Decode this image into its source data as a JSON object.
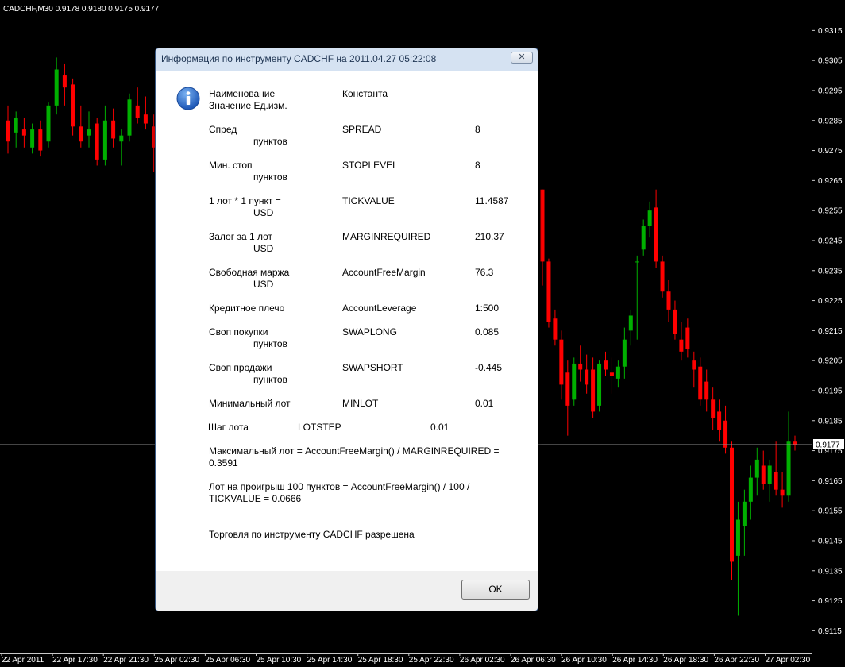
{
  "chart_data": {
    "type": "candlestick",
    "title": "CADCHF,M30  0.9178 0.9180 0.9175 0.9177",
    "symbol": "CADCHF",
    "timeframe": "M30",
    "quote": {
      "open": 0.9178,
      "high": 0.918,
      "low": 0.9175,
      "close": 0.9177
    },
    "current_price_label": "0.9177",
    "current_price": 0.9177,
    "ylim": [
      0.911,
      0.9322
    ],
    "y_ticks": [
      "0.9315",
      "0.9305",
      "0.9295",
      "0.9285",
      "0.9275",
      "0.9265",
      "0.9255",
      "0.9245",
      "0.9235",
      "0.9225",
      "0.9215",
      "0.9205",
      "0.9195",
      "0.9185",
      "0.9175",
      "0.9165",
      "0.9155",
      "0.9145",
      "0.9135",
      "0.9125",
      "0.9115"
    ],
    "x_ticks": [
      "22 Apr 2011",
      "22 Apr 17:30",
      "22 Apr 21:30",
      "25 Apr 02:30",
      "25 Apr 06:30",
      "25 Apr 10:30",
      "25 Apr 14:30",
      "25 Apr 18:30",
      "25 Apr 22:30",
      "26 Apr 02:30",
      "26 Apr 06:30",
      "26 Apr 10:30",
      "26 Apr 14:30",
      "26 Apr 18:30",
      "26 Apr 22:30",
      "27 Apr 02:30"
    ],
    "bull_color": "#00b000",
    "bear_color": "#ff0000",
    "background": "#000000",
    "grid": false,
    "candles": [
      {
        "o": 0.9285,
        "h": 0.929,
        "l": 0.9274,
        "c": 0.9278
      },
      {
        "o": 0.9281,
        "h": 0.9288,
        "l": 0.9276,
        "c": 0.9286
      },
      {
        "o": 0.9282,
        "h": 0.9286,
        "l": 0.9276,
        "c": 0.928
      },
      {
        "o": 0.9276,
        "h": 0.9284,
        "l": 0.9274,
        "c": 0.9282
      },
      {
        "o": 0.9282,
        "h": 0.9285,
        "l": 0.9273,
        "c": 0.9275
      },
      {
        "o": 0.9278,
        "h": 0.9291,
        "l": 0.9276,
        "c": 0.929
      },
      {
        "o": 0.929,
        "h": 0.9306,
        "l": 0.9287,
        "c": 0.9302
      },
      {
        "o": 0.93,
        "h": 0.9304,
        "l": 0.929,
        "c": 0.9296
      },
      {
        "o": 0.9297,
        "h": 0.9299,
        "l": 0.928,
        "c": 0.9283
      },
      {
        "o": 0.9283,
        "h": 0.929,
        "l": 0.9276,
        "c": 0.9278
      },
      {
        "o": 0.928,
        "h": 0.9288,
        "l": 0.9276,
        "c": 0.9282
      },
      {
        "o": 0.9284,
        "h": 0.9286,
        "l": 0.927,
        "c": 0.9272
      },
      {
        "o": 0.9272,
        "h": 0.929,
        "l": 0.927,
        "c": 0.9285
      },
      {
        "o": 0.9285,
        "h": 0.9289,
        "l": 0.9276,
        "c": 0.9279
      },
      {
        "o": 0.9278,
        "h": 0.9282,
        "l": 0.927,
        "c": 0.928
      },
      {
        "o": 0.928,
        "h": 0.9294,
        "l": 0.9278,
        "c": 0.9292
      },
      {
        "o": 0.929,
        "h": 0.9296,
        "l": 0.9284,
        "c": 0.9286
      },
      {
        "o": 0.9287,
        "h": 0.9293,
        "l": 0.9282,
        "c": 0.9284
      },
      {
        "o": 0.9283,
        "h": 0.9287,
        "l": 0.9268,
        "c": 0.9276
      },
      {
        "o": 0.9276,
        "h": 0.9286,
        "l": 0.9268,
        "c": 0.9283
      },
      {
        "o": 0.9262,
        "h": 0.9262,
        "l": 0.923,
        "c": 0.9238
      },
      {
        "o": 0.9238,
        "h": 0.9239,
        "l": 0.9216,
        "c": 0.9218
      },
      {
        "o": 0.9219,
        "h": 0.9222,
        "l": 0.921,
        "c": 0.9212
      },
      {
        "o": 0.9212,
        "h": 0.9215,
        "l": 0.9192,
        "c": 0.9197
      },
      {
        "o": 0.9201,
        "h": 0.9205,
        "l": 0.918,
        "c": 0.919
      },
      {
        "o": 0.9192,
        "h": 0.9206,
        "l": 0.919,
        "c": 0.9204
      },
      {
        "o": 0.9204,
        "h": 0.921,
        "l": 0.9198,
        "c": 0.9202
      },
      {
        "o": 0.9202,
        "h": 0.9207,
        "l": 0.9194,
        "c": 0.9197
      },
      {
        "o": 0.9202,
        "h": 0.9206,
        "l": 0.9186,
        "c": 0.9188
      },
      {
        "o": 0.919,
        "h": 0.9205,
        "l": 0.9188,
        "c": 0.9204
      },
      {
        "o": 0.9205,
        "h": 0.9208,
        "l": 0.92,
        "c": 0.9202
      },
      {
        "o": 0.9201,
        "h": 0.9206,
        "l": 0.9194,
        "c": 0.92
      },
      {
        "o": 0.9199,
        "h": 0.9205,
        "l": 0.9196,
        "c": 0.9203
      },
      {
        "o": 0.9203,
        "h": 0.9216,
        "l": 0.9199,
        "c": 0.9212
      },
      {
        "o": 0.9215,
        "h": 0.9222,
        "l": 0.921,
        "c": 0.922
      },
      {
        "o": 0.9238,
        "h": 0.924,
        "l": 0.9212,
        "c": 0.9238
      },
      {
        "o": 0.9242,
        "h": 0.9252,
        "l": 0.924,
        "c": 0.925
      },
      {
        "o": 0.925,
        "h": 0.9258,
        "l": 0.9246,
        "c": 0.9255
      },
      {
        "o": 0.9256,
        "h": 0.9262,
        "l": 0.9236,
        "c": 0.9238
      },
      {
        "o": 0.9238,
        "h": 0.924,
        "l": 0.9226,
        "c": 0.9228
      },
      {
        "o": 0.9228,
        "h": 0.9232,
        "l": 0.9218,
        "c": 0.9222
      },
      {
        "o": 0.9222,
        "h": 0.9225,
        "l": 0.9212,
        "c": 0.9214
      },
      {
        "o": 0.9212,
        "h": 0.9218,
        "l": 0.9205,
        "c": 0.9208
      },
      {
        "o": 0.9216,
        "h": 0.9219,
        "l": 0.9206,
        "c": 0.9209
      },
      {
        "o": 0.9205,
        "h": 0.9208,
        "l": 0.9196,
        "c": 0.9202
      },
      {
        "o": 0.9203,
        "h": 0.9206,
        "l": 0.919,
        "c": 0.9192
      },
      {
        "o": 0.9198,
        "h": 0.9202,
        "l": 0.9188,
        "c": 0.9192
      },
      {
        "o": 0.9192,
        "h": 0.9196,
        "l": 0.9182,
        "c": 0.9186
      },
      {
        "o": 0.9188,
        "h": 0.9192,
        "l": 0.9178,
        "c": 0.9182
      },
      {
        "o": 0.9185,
        "h": 0.919,
        "l": 0.9174,
        "c": 0.9176
      },
      {
        "o": 0.9176,
        "h": 0.9178,
        "l": 0.9132,
        "c": 0.9138
      },
      {
        "o": 0.914,
        "h": 0.9158,
        "l": 0.912,
        "c": 0.9152
      },
      {
        "o": 0.915,
        "h": 0.9162,
        "l": 0.914,
        "c": 0.9158
      },
      {
        "o": 0.9158,
        "h": 0.917,
        "l": 0.9152,
        "c": 0.9166
      },
      {
        "o": 0.9166,
        "h": 0.9176,
        "l": 0.916,
        "c": 0.9172
      },
      {
        "o": 0.917,
        "h": 0.9175,
        "l": 0.9162,
        "c": 0.9164
      },
      {
        "o": 0.9164,
        "h": 0.9172,
        "l": 0.9158,
        "c": 0.917
      },
      {
        "o": 0.9168,
        "h": 0.9178,
        "l": 0.916,
        "c": 0.9162
      },
      {
        "o": 0.9162,
        "h": 0.9168,
        "l": 0.9156,
        "c": 0.916
      },
      {
        "o": 0.916,
        "h": 0.9188,
        "l": 0.9158,
        "c": 0.9178
      },
      {
        "o": 0.9178,
        "h": 0.918,
        "l": 0.9175,
        "c": 0.9177
      }
    ]
  },
  "dialog": {
    "title": "Информация по инструменту CADCHF на 2011.04.27 05:22:08",
    "close_label": "✕",
    "icon": "info-icon",
    "header": {
      "name_col": "Наименование",
      "value_units": "Значение Ед.изм.",
      "const_col": "Константа"
    },
    "rows": [
      {
        "name": "Спред",
        "unit": "пунктов",
        "const": "SPREAD",
        "value": "8"
      },
      {
        "name": "Мин. стоп",
        "unit": "пунктов",
        "const": "STOPLEVEL",
        "value": "8"
      },
      {
        "name": "1 лот * 1 пункт =",
        "unit": "USD",
        "const": "TICKVALUE",
        "value": "11.4587"
      },
      {
        "name": "Залог за 1 лот",
        "unit": "USD",
        "const": "MARGINREQUIRED",
        "value": "210.37"
      },
      {
        "name": "Свободная маржа",
        "unit": "USD",
        "const": "AccountFreeMargin",
        "value": "76.3"
      },
      {
        "name": "Кредитное плечо",
        "unit": "",
        "const": "AccountLeverage",
        "value": "1:500"
      },
      {
        "name": "Своп покупки",
        "unit": "пунктов",
        "const": "SWAPLONG",
        "value": "0.085"
      },
      {
        "name": "Своп продажи",
        "unit": "пунктов",
        "const": "SWAPSHORT",
        "value": "-0.445"
      },
      {
        "name": "Минимальный лот",
        "unit": "",
        "const": "MINLOT",
        "value": "0.01"
      }
    ],
    "step_row": {
      "name": "Шаг лота",
      "const": "LOTSTEP",
      "value": "0.01"
    },
    "max_lot_line1": "Максимальный лот = AccountFreeMargin() / MARGINREQUIRED =",
    "max_lot_line2": "0.3591",
    "loss_lot_line1": "Лот на проигрыш 100 пунктов = AccountFreeMargin() / 100 /",
    "loss_lot_line2": "TICKVALUE = 0.0666",
    "trading_status": "Торговля по инструменту CADCHF разрешена",
    "ok_label": "OK"
  }
}
